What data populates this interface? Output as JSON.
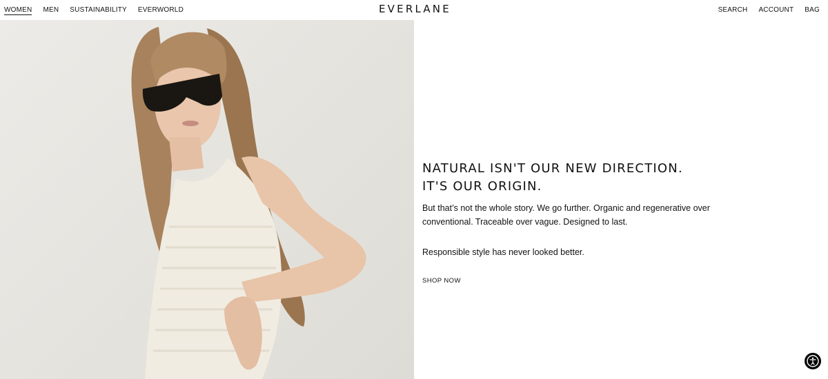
{
  "header": {
    "nav_left": [
      "WOMEN",
      "MEN",
      "SUSTAINABILITY",
      "EVERWORLD"
    ],
    "logo": "EVERLANE",
    "nav_right": [
      "SEARCH",
      "ACCOUNT",
      "BAG"
    ]
  },
  "hero": {
    "headline_line1": "NATURAL ISN'T OUR NEW DIRECTION.",
    "headline_line2": "IT'S OUR ORIGIN.",
    "body": "But that’s not the whole story. We go further. Organic and regenerative over conventional. Traceable over vague. Designed to last.",
    "tagline": "Responsible style has never looked better.",
    "cta_label": "SHOP NOW",
    "image_subject": "woman-in-crochet-dress-and-sunglasses"
  },
  "icons": {
    "accessibility": "accessibility-icon"
  },
  "colors": {
    "text": "#111111",
    "background": "#ffffff",
    "a11y_button": "#000000"
  }
}
